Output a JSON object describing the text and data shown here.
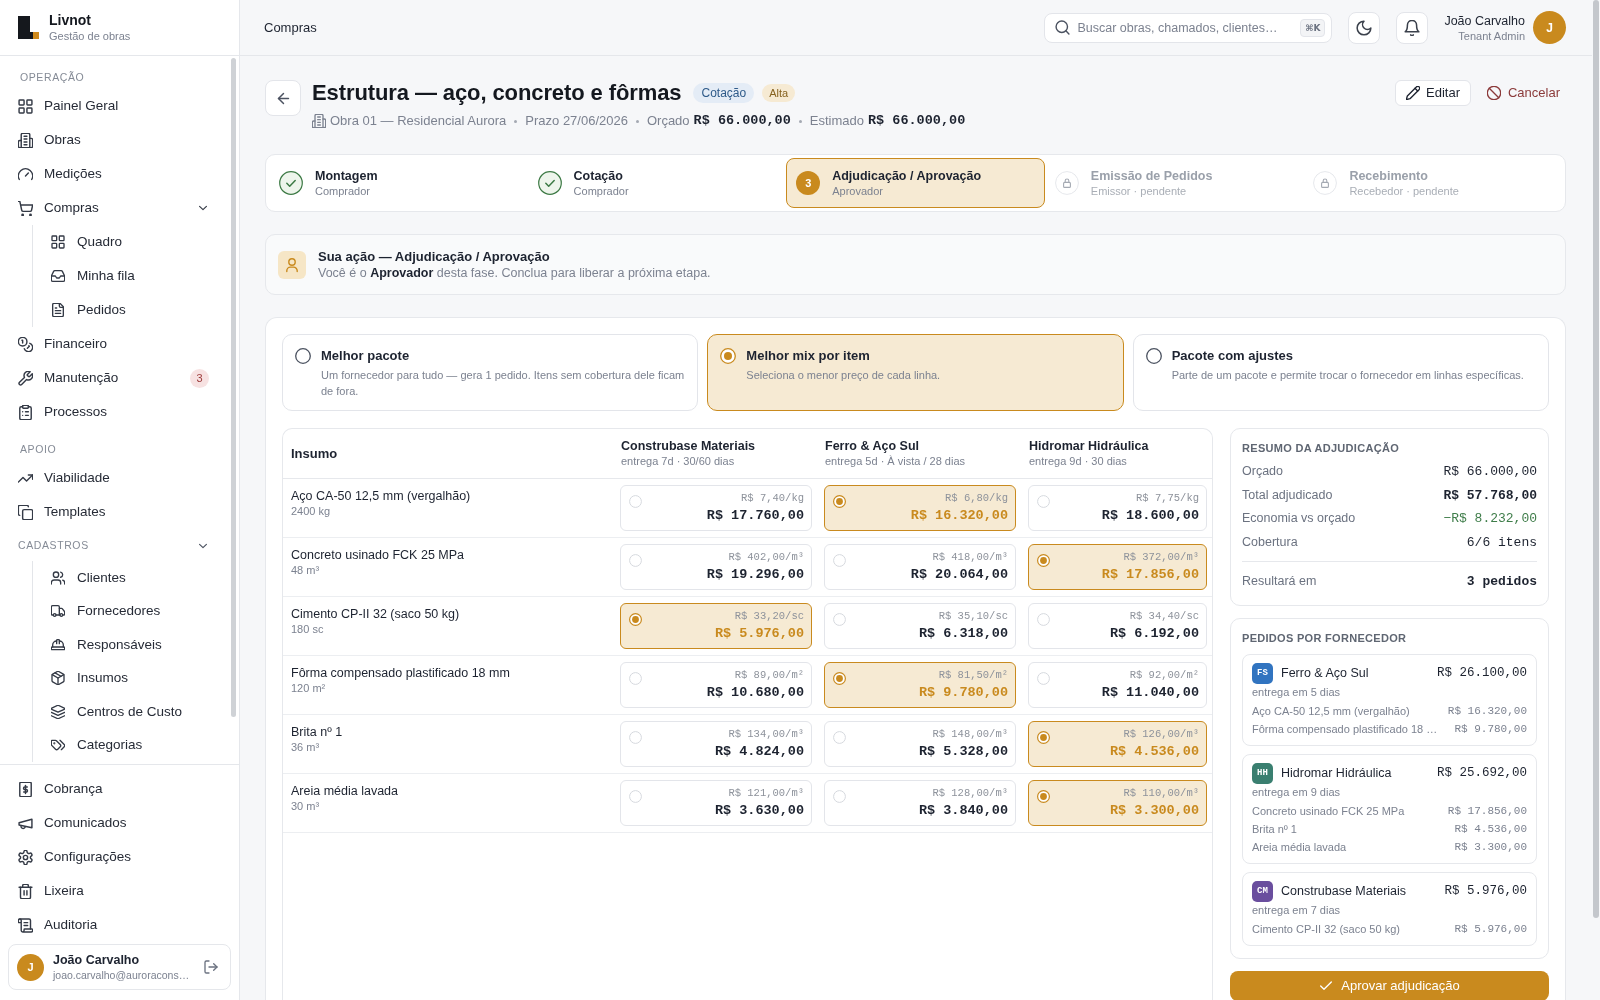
{
  "sidebar": {
    "brand": {
      "name": "Livnot",
      "tagline": "Gestão de obras"
    },
    "groups": [
      {
        "kind": "section",
        "label": "OPERAÇÃO",
        "items": [
          {
            "label": "Painel Geral"
          },
          {
            "label": "Obras"
          },
          {
            "label": "Medições"
          },
          {
            "label": "Compras",
            "expanded": true,
            "children": [
              {
                "label": "Quadro"
              },
              {
                "label": "Minha fila"
              },
              {
                "label": "Pedidos"
              }
            ]
          },
          {
            "label": "Financeiro"
          },
          {
            "label": "Manutenção",
            "badge": "3"
          },
          {
            "label": "Processos"
          }
        ]
      },
      {
        "kind": "section",
        "label": "APOIO",
        "items": [
          {
            "label": "Viabilidade"
          },
          {
            "label": "Templates"
          }
        ]
      },
      {
        "kind": "collapsible",
        "label": "CADASTROS",
        "expanded": true,
        "items": [
          {
            "label": "Clientes"
          },
          {
            "label": "Fornecedores"
          },
          {
            "label": "Responsáveis"
          },
          {
            "label": "Insumos"
          },
          {
            "label": "Centros de Custo"
          },
          {
            "label": "Categorias"
          }
        ]
      }
    ],
    "bottom_items": [
      {
        "label": "Cobrança"
      },
      {
        "label": "Comunicados"
      },
      {
        "label": "Configurações"
      },
      {
        "label": "Lixeira"
      },
      {
        "label": "Auditoria"
      }
    ],
    "user": {
      "initial": "J",
      "name": "João Carvalho",
      "email": "joao.carvalho@auroracons…"
    }
  },
  "topbar": {
    "breadcrumb": "Compras",
    "search": {
      "placeholder": "Buscar obras, chamados, clientes…",
      "shortcut": "⌘K"
    },
    "user": {
      "name": "João Carvalho",
      "role": "Tenant Admin",
      "initial": "J"
    }
  },
  "header": {
    "title": "Estrutura — aço, concreto e fôrmas",
    "badges": [
      {
        "label": "Cotação",
        "kind": "status"
      },
      {
        "label": "Alta",
        "kind": "priority"
      }
    ],
    "meta": {
      "project": "Obra 01 — Residencial Aurora",
      "deadline": "Prazo 27/06/2026",
      "budget_label": "Orçado",
      "budget_value": "R$ 66.000,00",
      "estimate_label": "Estimado",
      "estimate_value": "R$ 66.000,00"
    },
    "actions": [
      {
        "label": "Editar",
        "kind": "edit"
      },
      {
        "label": "Cancelar",
        "kind": "cancel"
      }
    ]
  },
  "stepper": {
    "steps": [
      {
        "title": "Montagem",
        "subtitle": "Comprador",
        "kind": "done"
      },
      {
        "title": "Cotação",
        "subtitle": "Comprador",
        "kind": "done"
      },
      {
        "title": "Adjudicação / Aprovação",
        "subtitle": "Aprovador",
        "kind": "current",
        "number": "3"
      },
      {
        "title": "Emissão de Pedidos",
        "subtitle": "Emissor · pendente",
        "kind": "locked"
      },
      {
        "title": "Recebimento",
        "subtitle": "Recebedor · pendente",
        "kind": "locked"
      }
    ]
  },
  "notice": {
    "title": "Sua ação — Adjudicação / Aprovação",
    "text": "Você é o **Aprovador** desta fase. Conclua para liberar a próxima etapa."
  },
  "strategies": [
    {
      "title": "Melhor pacote",
      "description": "Um fornecedor para tudo — gera 1 pedido. Itens sem cobertura dele ficam de fora.",
      "selected": false
    },
    {
      "title": "Melhor mix por item",
      "description": "Seleciona o menor preço de cada linha.",
      "selected": true
    },
    {
      "title": "Pacote com ajustes",
      "description": "Parte de um pacote e permite trocar o fornecedor em linhas específicas.",
      "selected": false
    }
  ],
  "comparison": {
    "item_header": "Insumo",
    "suppliers": [
      {
        "name": "Construbase Materiais",
        "terms": "entrega 7d · 30/60 dias"
      },
      {
        "name": "Ferro & Aço Sul",
        "terms": "entrega 5d · À vista / 28 dias"
      },
      {
        "name": "Hidromar Hidráulica",
        "terms": "entrega 9d · 30 dias"
      }
    ],
    "rows": [
      {
        "name": "Aço CA-50 12,5 mm (vergalhão)",
        "quantity": "2400 kg",
        "quotes": [
          {
            "unit_price": "R$ 7,40/kg",
            "total": "R$ 17.760,00",
            "selected": false
          },
          {
            "unit_price": "R$ 6,80/kg",
            "total": "R$ 16.320,00",
            "selected": true
          },
          {
            "unit_price": "R$ 7,75/kg",
            "total": "R$ 18.600,00",
            "selected": false
          }
        ]
      },
      {
        "name": "Concreto usinado FCK 25 MPa",
        "quantity": "48 m³",
        "quotes": [
          {
            "unit_price": "R$ 402,00/m³",
            "total": "R$ 19.296,00",
            "selected": false
          },
          {
            "unit_price": "R$ 418,00/m³",
            "total": "R$ 20.064,00",
            "selected": false
          },
          {
            "unit_price": "R$ 372,00/m³",
            "total": "R$ 17.856,00",
            "selected": true
          }
        ]
      },
      {
        "name": "Cimento CP-II 32 (saco 50 kg)",
        "quantity": "180 sc",
        "quotes": [
          {
            "unit_price": "R$ 33,20/sc",
            "total": "R$ 5.976,00",
            "selected": true
          },
          {
            "unit_price": "R$ 35,10/sc",
            "total": "R$ 6.318,00",
            "selected": false
          },
          {
            "unit_price": "R$ 34,40/sc",
            "total": "R$ 6.192,00",
            "selected": false
          }
        ]
      },
      {
        "name": "Fôrma compensado plastificado 18 mm",
        "quantity": "120 m²",
        "quotes": [
          {
            "unit_price": "R$ 89,00/m²",
            "total": "R$ 10.680,00",
            "selected": false
          },
          {
            "unit_price": "R$ 81,50/m²",
            "total": "R$ 9.780,00",
            "selected": true
          },
          {
            "unit_price": "R$ 92,00/m²",
            "total": "R$ 11.040,00",
            "selected": false
          }
        ]
      },
      {
        "name": "Brita nº 1",
        "quantity": "36 m³",
        "quotes": [
          {
            "unit_price": "R$ 134,00/m³",
            "total": "R$ 4.824,00",
            "selected": false
          },
          {
            "unit_price": "R$ 148,00/m³",
            "total": "R$ 5.328,00",
            "selected": false
          },
          {
            "unit_price": "R$ 126,00/m³",
            "total": "R$ 4.536,00",
            "selected": true
          }
        ]
      },
      {
        "name": "Areia média lavada",
        "quantity": "30 m³",
        "quotes": [
          {
            "unit_price": "R$ 121,00/m³",
            "total": "R$ 3.630,00",
            "selected": false
          },
          {
            "unit_price": "R$ 128,00/m³",
            "total": "R$ 3.840,00",
            "selected": false
          },
          {
            "unit_price": "R$ 110,00/m³",
            "total": "R$ 3.300,00",
            "selected": true
          }
        ]
      }
    ]
  },
  "summary": {
    "title": "RESUMO DA ADJUDICAÇÃO",
    "rows": [
      {
        "label": "Orçado",
        "value": "R$ 66.000,00",
        "kind": "plain"
      },
      {
        "label": "Total adjudicado",
        "value": "R$ 57.768,00",
        "kind": "strong"
      },
      {
        "label": "Economia vs orçado",
        "value": "−R$ 8.232,00",
        "kind": "saving"
      },
      {
        "label": "Cobertura",
        "value": "6/6 itens",
        "kind": "plain"
      },
      {
        "label": "Resultará em",
        "value": "3 pedidos",
        "kind": "result"
      }
    ]
  },
  "orders": {
    "title": "PEDIDOS POR FORNECEDOR",
    "suppliers": [
      {
        "initials": "FS",
        "color": "#3174c0",
        "name": "Ferro & Aço Sul",
        "total": "R$ 26.100,00",
        "delivery": "entrega em 5 dias",
        "lines": [
          {
            "item": "Aço CA-50 12,5 mm (vergalhão)",
            "value": "R$ 16.320,00"
          },
          {
            "item": "Fôrma compensado plastificado 18 …",
            "value": "R$ 9.780,00"
          }
        ]
      },
      {
        "initials": "HH",
        "color": "#3a7f70",
        "name": "Hidromar Hidráulica",
        "total": "R$ 25.692,00",
        "delivery": "entrega em 9 dias",
        "lines": [
          {
            "item": "Concreto usinado FCK 25 MPa",
            "value": "R$ 17.856,00"
          },
          {
            "item": "Brita nº 1",
            "value": "R$ 4.536,00"
          },
          {
            "item": "Areia média lavada",
            "value": "R$ 3.300,00"
          }
        ]
      },
      {
        "initials": "CM",
        "color": "#6a4e9e",
        "name": "Construbase Materiais",
        "total": "R$ 5.976,00",
        "delivery": "entrega em 7 dias",
        "lines": [
          {
            "item": "Cimento CP-II 32 (saco 50 kg)",
            "value": "R$ 5.976,00"
          }
        ]
      }
    ]
  },
  "approve_button": {
    "label": "Aprovar adjudicação"
  }
}
